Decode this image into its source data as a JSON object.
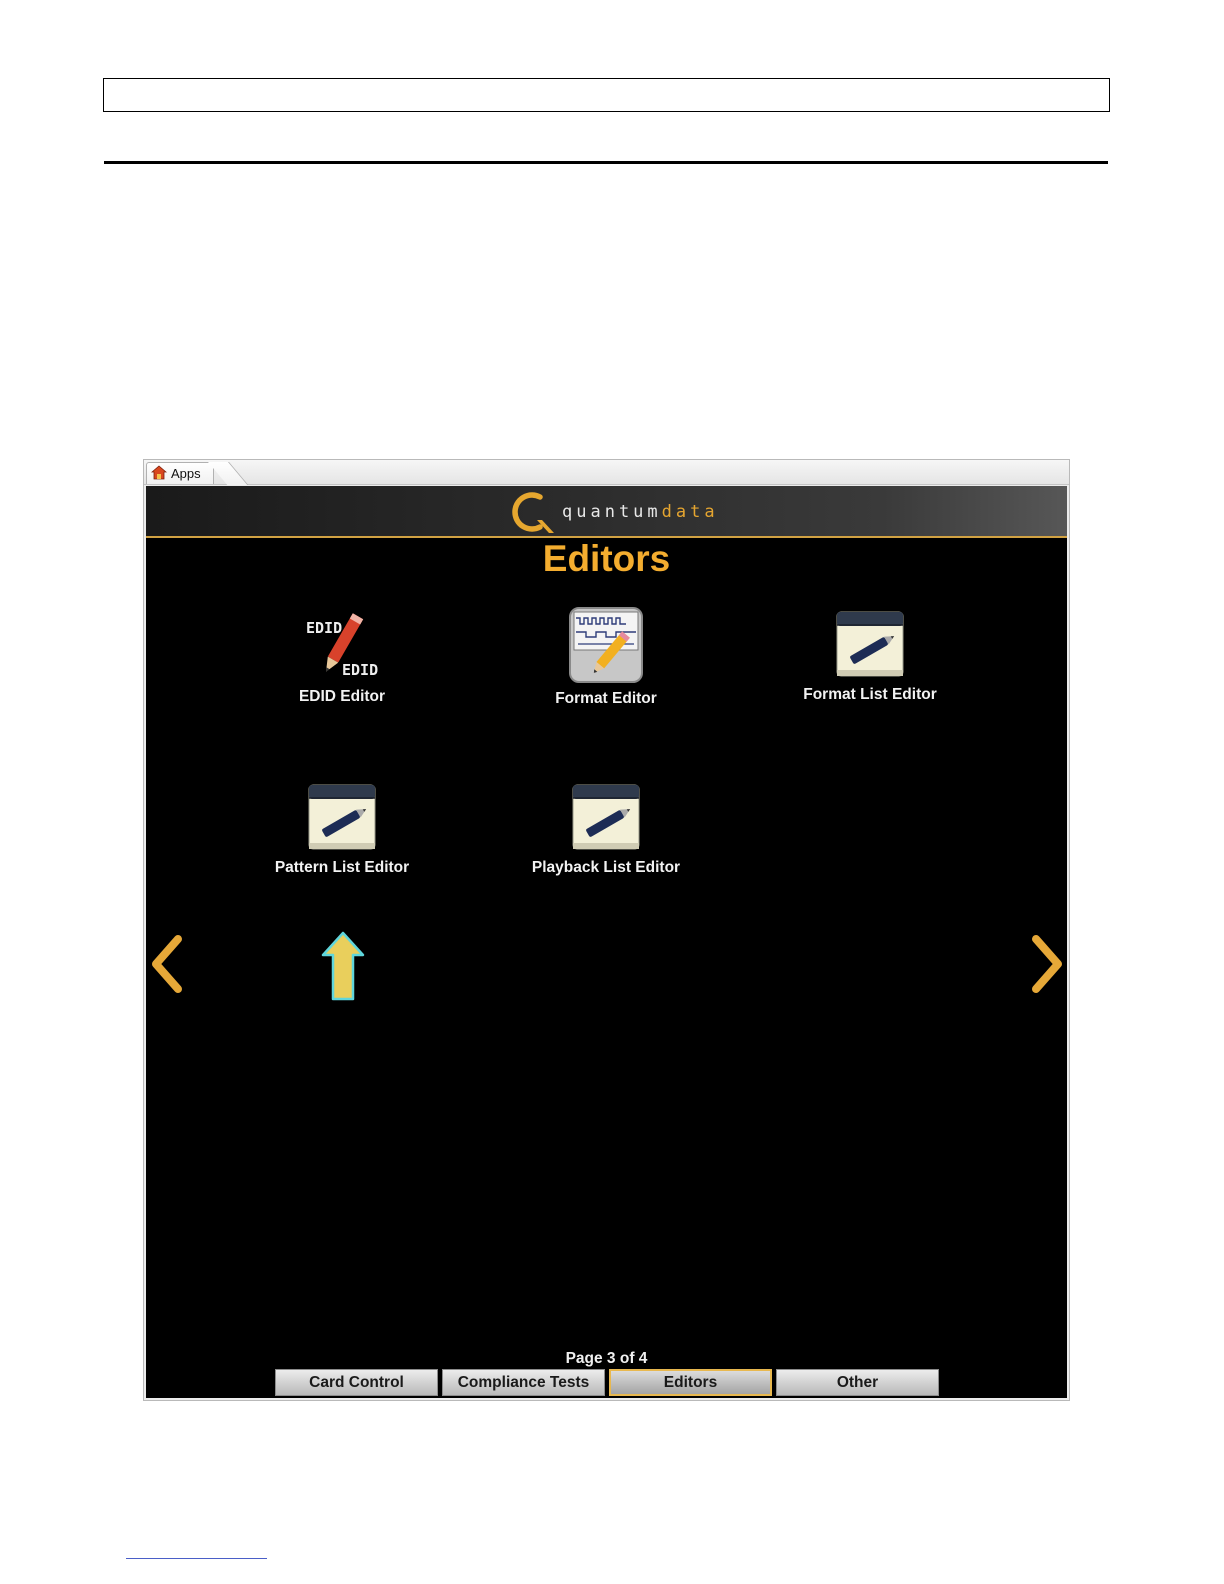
{
  "window": {
    "tab_label": "Apps",
    "tab_icon": "home-icon"
  },
  "brand": {
    "logo_letter": "Q",
    "logo_word_a": "quantum",
    "logo_word_b": "data",
    "accent": "#e5a530"
  },
  "page": {
    "title": "Editors",
    "indicator": "Page 3 of 4"
  },
  "apps": [
    {
      "label": "EDID Editor",
      "icon": "edid-pencil-icon"
    },
    {
      "label": "Format Editor",
      "icon": "format-editor-icon"
    },
    {
      "label": "Format List Editor",
      "icon": "notepad-pen-icon"
    },
    {
      "label": "Pattern List Editor",
      "icon": "notepad-pen-icon"
    },
    {
      "label": "Playback List Editor",
      "icon": "notepad-pen-icon"
    }
  ],
  "icon_text": {
    "edid_top": "EDID",
    "edid_bottom": "EDID"
  },
  "annotation": {
    "icon": "up-arrow-icon",
    "color": "#e9cf5c"
  },
  "nav": {
    "prev_icon": "chevron-left-icon",
    "next_icon": "chevron-right-icon"
  },
  "category_tabs": [
    {
      "label": "Card Control",
      "active": false
    },
    {
      "label": "Compliance Tests",
      "active": false
    },
    {
      "label": "Editors",
      "active": true
    },
    {
      "label": "Other",
      "active": false
    }
  ]
}
